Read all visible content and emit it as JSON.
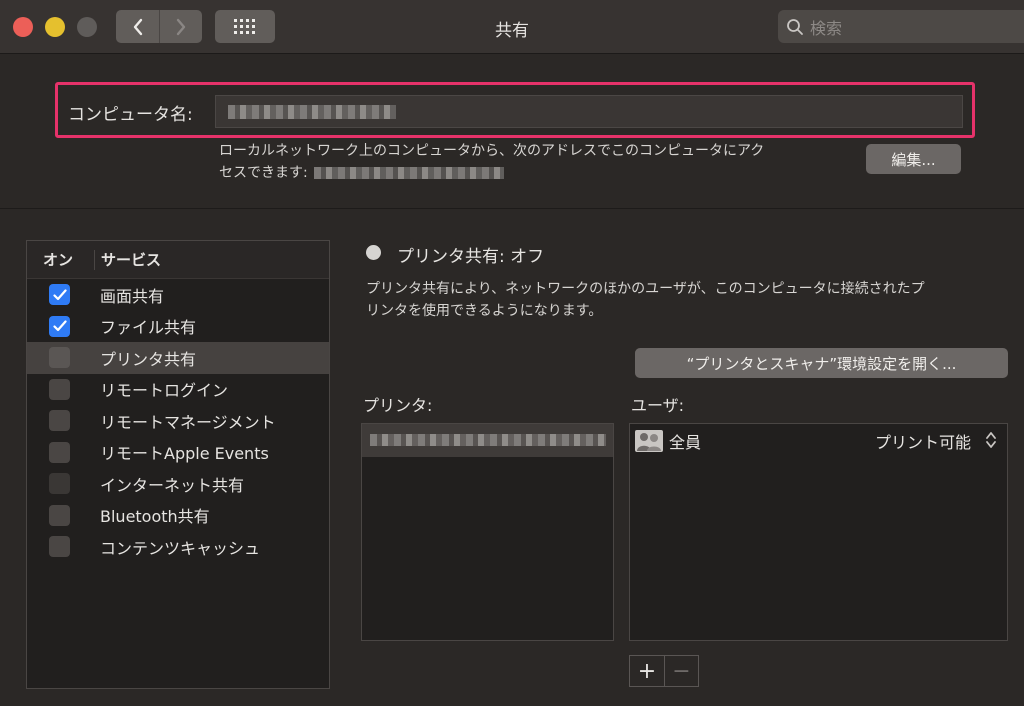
{
  "window": {
    "title": "共有",
    "search_placeholder": "検索"
  },
  "computer_name": {
    "label": "コンピュータ名:",
    "description_line1": "ローカルネットワーク上のコンピュータから、次のアドレスでこのコンピュータにアク",
    "description_line2": "セスできます:",
    "edit_button": "編集..."
  },
  "services": {
    "header_on": "オン",
    "header_service": "サービス",
    "items": [
      {
        "label": "画面共有",
        "checked": true
      },
      {
        "label": "ファイル共有",
        "checked": true
      },
      {
        "label": "プリンタ共有",
        "checked": false,
        "selected": true
      },
      {
        "label": "リモートログイン",
        "checked": false
      },
      {
        "label": "リモートマネージメント",
        "checked": false
      },
      {
        "label": "リモートApple Events",
        "checked": false
      },
      {
        "label": "インターネット共有",
        "checked": false
      },
      {
        "label": "Bluetooth共有",
        "checked": false
      },
      {
        "label": "コンテンツキャッシュ",
        "checked": false
      }
    ]
  },
  "detail": {
    "status": "プリンタ共有: オフ",
    "description_line1": "プリンタ共有により、ネットワークのほかのユーザが、このコンピュータに接続されたプ",
    "description_line2": "リンタを使用できるようになります。",
    "prefs_button": "“プリンタとスキャナ”環境設定を開く...",
    "printers_label": "プリンタ:",
    "users_label": "ユーザ:",
    "users": [
      {
        "name": "全員",
        "permission": "プリント可能"
      }
    ],
    "add_button": "+",
    "remove_button": "−"
  },
  "colors": {
    "highlight": "#e6326a",
    "checkbox_checked": "#2f7bf5"
  }
}
